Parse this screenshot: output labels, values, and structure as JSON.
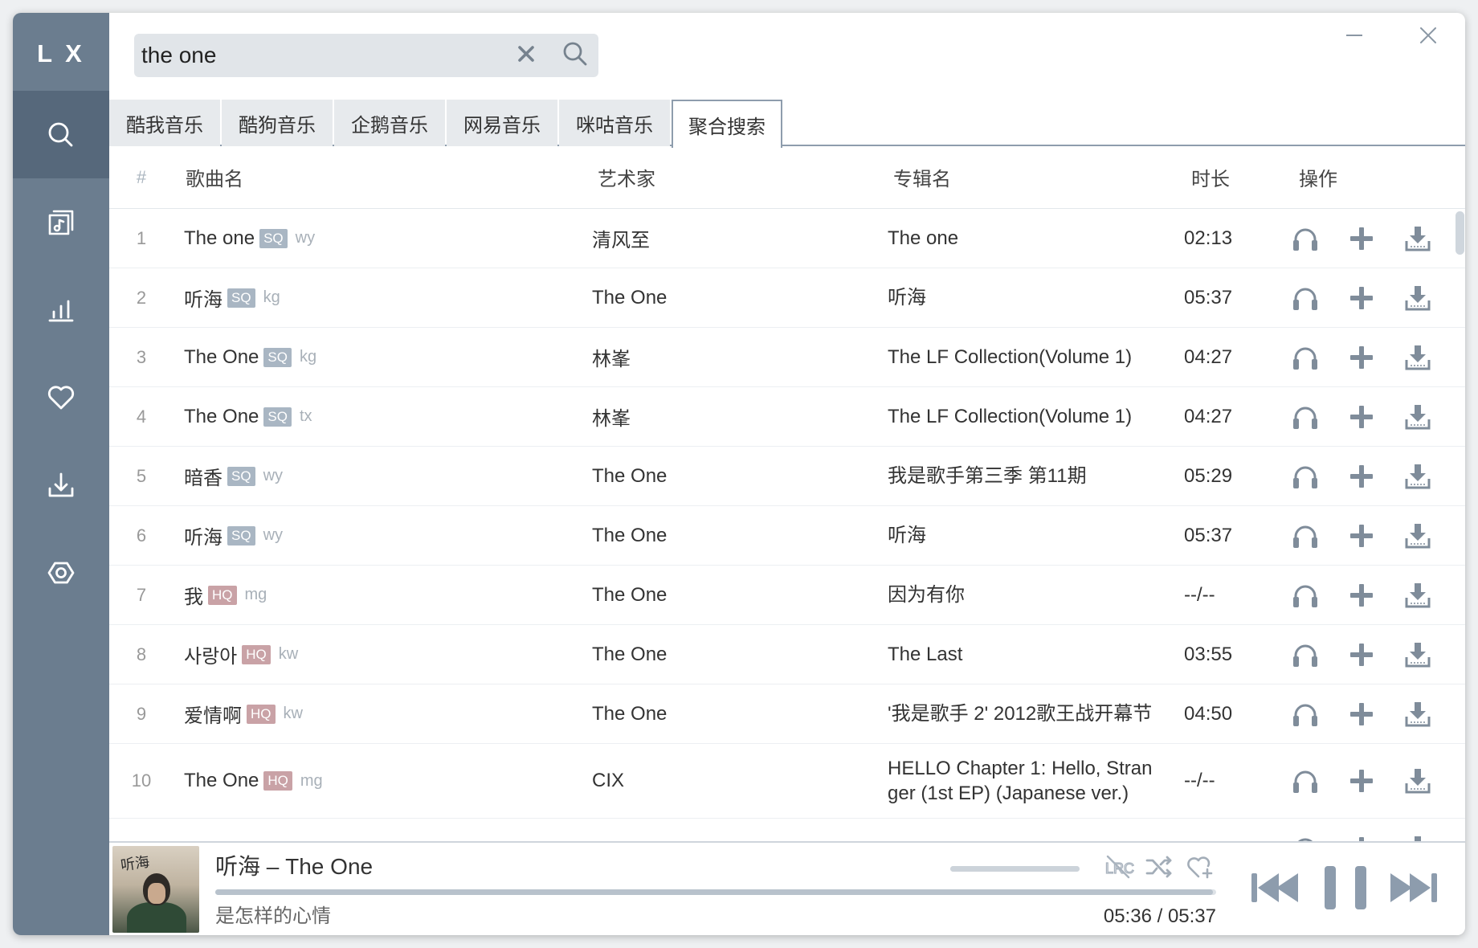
{
  "colors": {
    "sidebar": "#6b7d8f",
    "sidebar_active": "#56687b",
    "accent": "#8e9dad",
    "text": "#333333",
    "icon": "#7f8c9a",
    "sq_badge": "#a9b6c3",
    "hq_badge": "#c9a2a6",
    "search_bg": "#e1e5e9",
    "tab_bg": "#e7eaed"
  },
  "sidebar": {
    "logo": "L X",
    "items": [
      {
        "icon": "search-icon",
        "active": true
      },
      {
        "icon": "song-list-icon",
        "active": false
      },
      {
        "icon": "leaderboard-icon",
        "active": false
      },
      {
        "icon": "heart-icon",
        "active": false
      },
      {
        "icon": "download-icon",
        "active": false
      },
      {
        "icon": "settings-icon",
        "active": false
      }
    ]
  },
  "search": {
    "value": "the one",
    "clear_icon": "clear-icon",
    "search_icon": "search-icon"
  },
  "window_controls": {
    "minimize_icon": "minimize-icon",
    "close_icon": "close-icon"
  },
  "tabs": {
    "items": [
      "酷我音乐",
      "酷狗音乐",
      "企鹅音乐",
      "网易音乐",
      "咪咕音乐",
      "聚合搜索"
    ],
    "active": 5
  },
  "table": {
    "headers": {
      "index": "#",
      "name": "歌曲名",
      "artist": "艺术家",
      "album": "专辑名",
      "duration": "时长",
      "actions": "操作"
    },
    "row_actions": [
      "headphones-icon",
      "plus-icon",
      "download-icon"
    ],
    "rows": [
      {
        "index": "1",
        "name": "The one",
        "quality": "SQ",
        "source": "wy",
        "artist": "清风至",
        "album": "The one",
        "duration": "02:13"
      },
      {
        "index": "2",
        "name": "听海",
        "quality": "SQ",
        "source": "kg",
        "artist": "The One",
        "album": "听海",
        "duration": "05:37"
      },
      {
        "index": "3",
        "name": "The One",
        "quality": "SQ",
        "source": "kg",
        "artist": "林峯",
        "album": "The LF Collection(Volume 1)",
        "duration": "04:27"
      },
      {
        "index": "4",
        "name": "The One",
        "quality": "SQ",
        "source": "tx",
        "artist": "林峯",
        "album": "The LF Collection(Volume 1)",
        "duration": "04:27"
      },
      {
        "index": "5",
        "name": "暗香",
        "quality": "SQ",
        "source": "wy",
        "artist": "The One",
        "album": "我是歌手第三季 第11期",
        "duration": "05:29"
      },
      {
        "index": "6",
        "name": "听海",
        "quality": "SQ",
        "source": "wy",
        "artist": "The One",
        "album": "听海",
        "duration": "05:37"
      },
      {
        "index": "7",
        "name": "我",
        "quality": "HQ",
        "source": "mg",
        "artist": "The One",
        "album": "因为有你",
        "duration": "--/--"
      },
      {
        "index": "8",
        "name": "사랑아",
        "quality": "HQ",
        "source": "kw",
        "artist": "The One",
        "album": "The Last",
        "duration": "03:55"
      },
      {
        "index": "9",
        "name": "爱情啊",
        "quality": "HQ",
        "source": "kw",
        "artist": "The One",
        "album": "'我是歌手 2' 2012歌王战开幕节",
        "duration": "04:50"
      },
      {
        "index": "10",
        "name": "The One",
        "quality": "HQ",
        "source": "mg",
        "artist": "CIX",
        "album": "HELLO Chapter 1: Hello, Stranger (1st EP) (Japanese ver.)",
        "duration": "--/--"
      }
    ]
  },
  "player": {
    "title": "听海 – The One",
    "subtitle": "是怎样的心情",
    "current_time": "05:36",
    "time_separator": "/",
    "total_time": "05:37",
    "progress": 0.997,
    "volume": 1.0,
    "album_art_text": "听海",
    "lyrics_icon_text": "LRC",
    "icons": [
      "lyrics-off-icon",
      "shuffle-icon",
      "heart-plus-icon",
      "previous-icon",
      "pause-icon",
      "next-icon"
    ]
  }
}
